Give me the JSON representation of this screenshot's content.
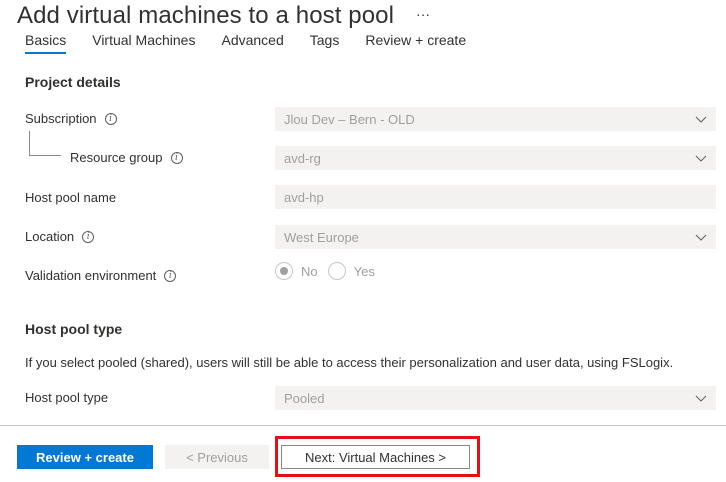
{
  "header": {
    "title": "Add virtual machines to a host pool",
    "more": "···"
  },
  "tabs": [
    {
      "label": "Basics",
      "active": true
    },
    {
      "label": "Virtual Machines",
      "active": false
    },
    {
      "label": "Advanced",
      "active": false
    },
    {
      "label": "Tags",
      "active": false
    },
    {
      "label": "Review + create",
      "active": false
    }
  ],
  "project_details": {
    "heading": "Project details",
    "subscription": {
      "label": "Subscription",
      "value": "Jlou Dev – Bern - OLD"
    },
    "resource_group": {
      "label": "Resource group",
      "value": "avd-rg"
    },
    "host_pool_name": {
      "label": "Host pool name",
      "value": "avd-hp"
    },
    "location": {
      "label": "Location",
      "value": "West Europe"
    },
    "validation_environment": {
      "label": "Validation environment",
      "options": [
        "No",
        "Yes"
      ],
      "selected": "No"
    }
  },
  "host_pool_type_section": {
    "heading": "Host pool type",
    "description": "If you select pooled (shared), users will still be able to access their personalization and user data, using FSLogix.",
    "field": {
      "label": "Host pool type",
      "value": "Pooled"
    }
  },
  "footer": {
    "review_create": "Review + create",
    "previous": "< Previous",
    "next": "Next: Virtual Machines >"
  },
  "colors": {
    "accent": "#0078d4",
    "highlight": "#e3101a",
    "disabled_bg": "#f3f2f1"
  }
}
